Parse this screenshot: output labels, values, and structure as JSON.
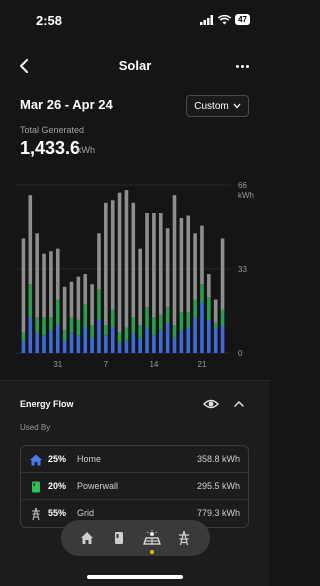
{
  "status": {
    "time": "2:58",
    "battery": "47"
  },
  "nav": {
    "title": "Solar"
  },
  "range": {
    "dates": "Mar 26 - Apr 24",
    "custom_label": "Custom"
  },
  "total": {
    "label": "Total Generated",
    "value": "1,433.6",
    "unit": "kWh"
  },
  "chart_data": {
    "type": "bar",
    "stacked": true,
    "categories": [
      "Mar 26",
      "Mar 27",
      "Mar 28",
      "Mar 29",
      "Mar 30",
      "Mar 31",
      "Apr 1",
      "Apr 2",
      "Apr 3",
      "Apr 4",
      "Apr 5",
      "Apr 6",
      "Apr 7",
      "Apr 8",
      "Apr 9",
      "Apr 10",
      "Apr 11",
      "Apr 12",
      "Apr 13",
      "Apr 14",
      "Apr 15",
      "Apr 16",
      "Apr 17",
      "Apr 18",
      "Apr 19",
      "Apr 20",
      "Apr 21",
      "Apr 22",
      "Apr 23",
      "Apr 24"
    ],
    "x_tick_labels": [
      {
        "index": 5,
        "label": "31"
      },
      {
        "index": 12,
        "label": "7"
      },
      {
        "index": 19,
        "label": "14"
      },
      {
        "index": 26,
        "label": "21"
      }
    ],
    "y_tick_labels": [
      "66",
      "33",
      "0"
    ],
    "ylabel": "kWh",
    "ylim": [
      0,
      66
    ],
    "series": [
      {
        "name": "Home",
        "color": "#3e6bd8",
        "values": [
          5,
          14,
          8,
          7,
          9,
          11,
          5,
          8,
          7,
          10,
          6,
          13,
          7,
          10,
          4,
          5,
          8,
          6,
          10,
          7,
          9,
          12,
          6,
          9,
          10,
          14,
          20,
          13,
          10,
          11
        ]
      },
      {
        "name": "Powerwall",
        "color": "#2a9d4f",
        "values": [
          3,
          13,
          6,
          7,
          5,
          10,
          4,
          6,
          6,
          9,
          5,
          12,
          4,
          7,
          4,
          5,
          6,
          5,
          8,
          7,
          6,
          6,
          5,
          7,
          6,
          7,
          7,
          9,
          2,
          6
        ]
      },
      {
        "name": "Grid",
        "color": "#8e8e8e",
        "values": [
          37,
          35,
          33,
          25,
          26,
          20,
          17,
          14,
          17,
          12,
          16,
          22,
          48,
          43,
          55,
          54,
          45,
          30,
          37,
          41,
          40,
          31,
          51,
          37,
          38,
          26,
          23,
          9,
          9,
          28
        ]
      }
    ]
  },
  "flow": {
    "title": "Energy Flow",
    "used_by": "Used By",
    "rows": [
      {
        "icon": "home-icon",
        "pct": "25%",
        "name": "Home",
        "value": "358.8 kWh",
        "color": "#4a7cf0"
      },
      {
        "icon": "powerwall-icon",
        "pct": "20%",
        "name": "Powerwall",
        "value": "295.5 kWh",
        "color": "#2fbf5b"
      },
      {
        "icon": "grid-icon",
        "pct": "55%",
        "name": "Grid",
        "value": "779.3 kWh",
        "color": "#9a9a9a"
      }
    ]
  },
  "bottom_nav": {
    "items": [
      "house-icon",
      "vehicle-icon",
      "solar-icon",
      "grid-tower-icon"
    ],
    "active": "solar-icon",
    "active_color": "#f4b400"
  }
}
